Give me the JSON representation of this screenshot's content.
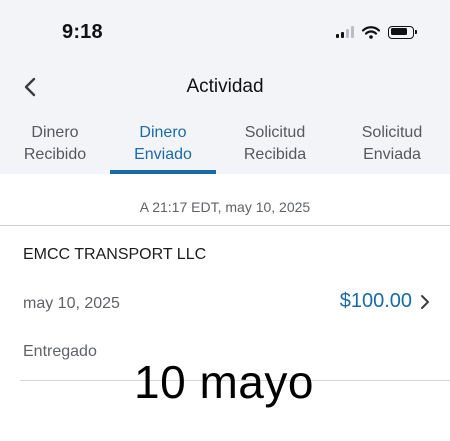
{
  "status_bar": {
    "time": "9:18",
    "signal_icon": "cellular-signal-icon",
    "wifi_icon": "wifi-icon",
    "battery_icon": "battery-icon"
  },
  "nav": {
    "back_icon": "chevron-left-icon",
    "title": "Actividad"
  },
  "tabs": [
    {
      "line1": "Dinero",
      "line2": "Recibido",
      "active": false
    },
    {
      "line1": "Dinero",
      "line2": "Enviado",
      "active": true
    },
    {
      "line1": "Solicitud",
      "line2": "Recibida",
      "active": false
    },
    {
      "line1": "Solicitud",
      "line2": "Enviada",
      "active": false
    }
  ],
  "activity": {
    "timestamp": "A 21:17 EDT, may 10, 2025",
    "merchant": "EMCC TRANSPORT LLC",
    "date": "may 10, 2025",
    "amount": "$100.00",
    "status": "Entregado",
    "detail_icon": "chevron-right-icon"
  },
  "overlay_text": "10 mayo",
  "colors": {
    "accent": "#1a6aa6",
    "header_bg": "#f3f4f8",
    "muted_text": "#5f6268"
  }
}
